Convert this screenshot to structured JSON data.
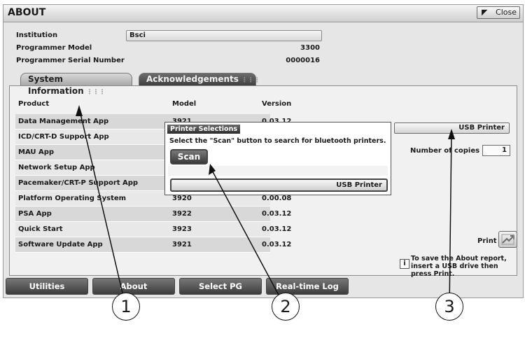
{
  "window": {
    "title": "ABOUT",
    "close_label": "Close"
  },
  "info_fields": {
    "institution_label": "Institution",
    "institution_value": "Bsci",
    "programmer_model_label": "Programmer Model",
    "programmer_model_value": "3300",
    "serial_label": "Programmer Serial Number",
    "serial_value": "0000016"
  },
  "tabs": [
    {
      "label": "System Information",
      "active": true
    },
    {
      "label": "Acknowledgements",
      "active": false
    }
  ],
  "table": {
    "headers": [
      "Product",
      "Model",
      "Version"
    ],
    "rows": [
      {
        "product": "Data Management App",
        "model": "3921",
        "version": "0.03.12"
      },
      {
        "product": "ICD/CRT-D Support App",
        "model": "",
        "version": ""
      },
      {
        "product": "MAU App",
        "model": "",
        "version": ""
      },
      {
        "product": "Network Setup App",
        "model": "",
        "version": ""
      },
      {
        "product": "Pacemaker/CRT-P Support App",
        "model": "",
        "version": ""
      },
      {
        "product": "Platform Operating System",
        "model": "3920",
        "version": "0.00.08"
      },
      {
        "product": "PSA App",
        "model": "3922",
        "version": "0.03.12"
      },
      {
        "product": "Quick Start",
        "model": "3923",
        "version": "0.03.12"
      },
      {
        "product": "Software Update App",
        "model": "3921",
        "version": "0.03.12"
      }
    ]
  },
  "printer": {
    "selected": "USB Printer",
    "copies_label": "Number of copies",
    "copies_value": "1",
    "print_label": "Print",
    "info_text": "To save the About report, insert a USB drive then press Print."
  },
  "dialog": {
    "title": "Printer Selections",
    "message": "Select the \"Scan\" button to search for bluetooth printers.",
    "scan_label": "Scan",
    "usb_option": "USB Printer"
  },
  "nav": {
    "buttons": [
      "Utilities",
      "About",
      "Select PG",
      "Real-time Log"
    ]
  },
  "callouts": [
    "1",
    "2",
    "3"
  ]
}
